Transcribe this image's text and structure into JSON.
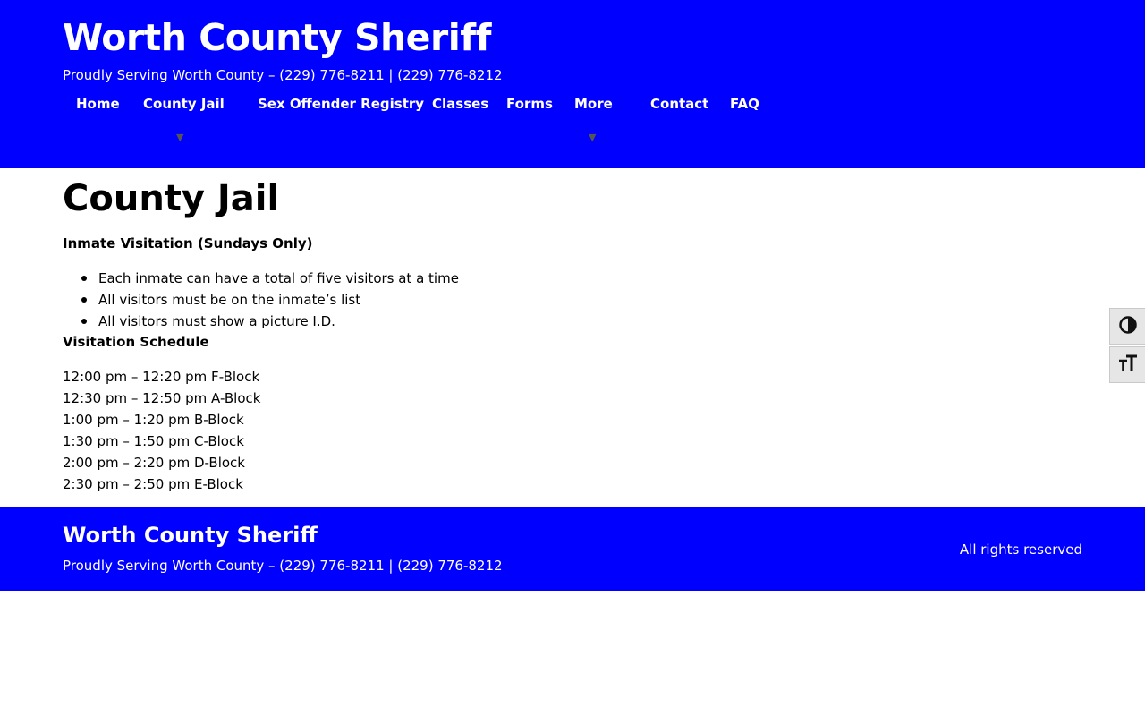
{
  "header": {
    "site_title": "Worth County Sheriff",
    "tagline": "Proudly Serving Worth County – (229) 776-8211 | (229) 776-8212",
    "background_color": "#0000ff"
  },
  "nav": {
    "items": [
      {
        "label": "Home"
      },
      {
        "label": "County Jail",
        "has_submenu": true
      },
      {
        "label": "Sex Offender Registry"
      },
      {
        "label": "Classes"
      },
      {
        "label": "Forms"
      },
      {
        "label": "More",
        "has_submenu": true
      },
      {
        "label": "Contact"
      },
      {
        "label": "FAQ"
      }
    ],
    "submenu_indicator": "▼"
  },
  "main": {
    "page_title": "County Jail",
    "visitation_heading": "Inmate Visitation (Sundays Only)",
    "rules": [
      "Each inmate can have a total of five visitors at a time",
      "All visitors must be on the inmate’s list",
      "All visitors must show a picture I.D."
    ],
    "schedule_heading": "Visitation Schedule",
    "schedule": [
      "12:00 pm – 12:20 pm F-Block",
      "12:30 pm – 12:50 pm A-Block",
      "1:00 pm – 1:20 pm B-Block",
      "1:30 pm – 1:50 pm C-Block",
      "2:00 pm – 2:20 pm D-Block",
      "2:30 pm – 2:50 pm E-Block"
    ]
  },
  "accessibility_toolbar": {
    "buttons": [
      {
        "icon": "contrast-icon"
      },
      {
        "icon": "font-resize-icon"
      }
    ]
  },
  "footer": {
    "site_title": "Worth County Sheriff",
    "tagline": "Proudly Serving Worth County – (229) 776-8211 | (229) 776-8212",
    "rights": "All rights reserved"
  }
}
